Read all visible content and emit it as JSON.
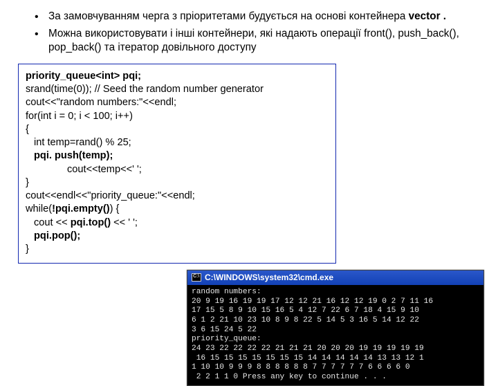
{
  "bullets": [
    {
      "pre": "За замовчуванням черга з пріоритетами будується на основі контейнера ",
      "bold": "vector .",
      "post": ""
    },
    {
      "pre": "Можна використовувати і інші контейнери, які надають операції front(), push_back(), pop_back()  та ітератор довільного доступу",
      "bold": "",
      "post": ""
    }
  ],
  "code": {
    "l01_b": "priority_queue<int> pqi;",
    "l02": "srand(time(0)); // Seed the random number generator",
    "l03": "cout<<\"random numbers:\"<<endl;",
    "l04": "for(int i = 0; i < 100; i++)",
    "l05": "{",
    "l06": "int temp=rand() % 25;",
    "l07_b": "pqi. push(temp);",
    "l08": "cout<<temp<<' ';",
    "l09": "}",
    "l10": "cout<<endl<<\"priority_queue:\"<<endl;",
    "l11a": "while(",
    "l11b_b": "!pqi.empty()",
    "l11c": ") {",
    "l12a": "cout << ",
    "l12b_b": "pqi.top()",
    "l12c": " << ' ';",
    "l13_b": "pqi.pop();",
    "l14": "}"
  },
  "terminal": {
    "title": "C:\\WINDOWS\\system32\\cmd.exe",
    "lines": [
      "random numbers:",
      "20 9 19 16 19 19 17 12 12 21 16 12 12 19 0 2 7 11 16",
      "17 15 5 8 9 10 15 16 5 4 12 7 22 6 7 18 4 15 9 10",
      "6 1 2 21 10 23 10 8 9 8 22 5 14 5 3 16 5 14 12 22",
      "3 6 15 24 5 22",
      "priority_queue:",
      "24 23 22 22 22 22 21 21 21 20 20 20 19 19 19 19 19",
      " 16 15 15 15 15 15 15 15 14 14 14 14 14 13 13 12 1",
      "1 10 10 9 9 9 8 8 8 8 8 8 7 7 7 7 7 7 6 6 6 6 0",
      " 2 2 1 1 0 Press any key to continue . . ."
    ]
  }
}
